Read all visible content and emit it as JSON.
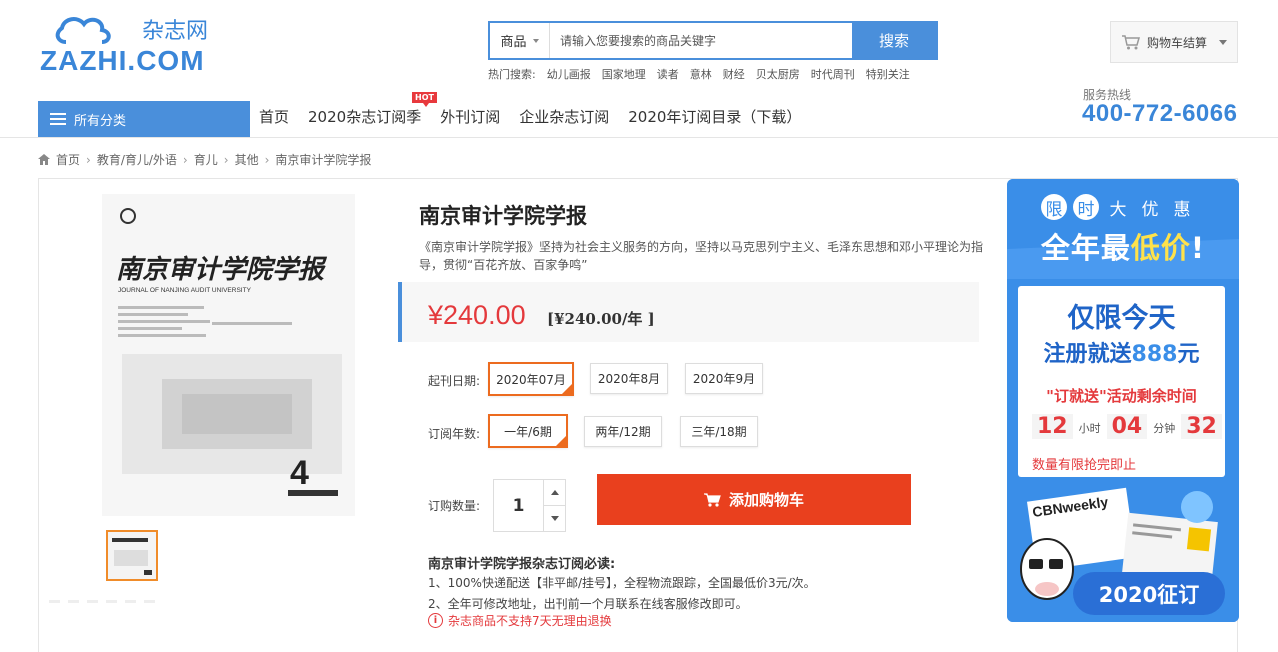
{
  "header": {
    "logo_text_cn": "杂志网",
    "logo_text_en": "ZAZHI.COM",
    "search": {
      "category": "商品",
      "placeholder": "请输入您要搜索的商品关键字",
      "button": "搜索"
    },
    "hot_label": "热门搜索:",
    "hot_terms": [
      "幼儿画报",
      "国家地理",
      "读者",
      "意林",
      "财经",
      "贝太厨房",
      "时代周刊",
      "特别关注"
    ],
    "cart": "购物车结算",
    "service_label": "服务热线",
    "service_phone": "400-772-6066"
  },
  "nav": {
    "all_categories": "所有分类",
    "items": [
      "首页",
      "2020杂志订阅季",
      "外刊订阅",
      "企业杂志订阅",
      "2020年订阅目录（下载）"
    ],
    "hot_badge": "HOT"
  },
  "breadcrumb": [
    "首页",
    "教育/育儿/外语",
    "育儿",
    "其他",
    "南京审计学院学报"
  ],
  "product": {
    "title": "南京审计学院学报",
    "description": "《南京审计学院学报》坚持为社会主义服务的方向，坚持以马克思列宁主义、毛泽东思想和邓小平理论为指导，贯彻“百花齐放、百家争鸣”",
    "price": "¥240.00",
    "price_per_year": "[¥240.00/年 ]",
    "cover_title": "南京审计学院学报",
    "cover_subtitle": "JOURNAL OF NANJING AUDIT UNIVERSITY",
    "cover_issue": "4",
    "start_label": "起刊日期:",
    "start_options": [
      "2020年07月",
      "2020年8月",
      "2020年9月"
    ],
    "start_selected": 0,
    "years_label": "订阅年数:",
    "year_options": [
      "一年/6期",
      "两年/12期",
      "三年/18期"
    ],
    "year_selected": 0,
    "qty_label": "订购数量:",
    "qty": "1",
    "add_cart": "添加购物车",
    "notes_title": "南京审计学院学报杂志订阅必读:",
    "notes": [
      "1、100%快递配送【非平邮/挂号】，全程物流跟踪，全国最低价3元/次。",
      "2、全年可修改地址，出刊前一个月联系在线客服修改即可。"
    ],
    "warning": "杂志商品不支持7天无理由退换"
  },
  "ad": {
    "small_chars": [
      "限",
      "时",
      "大",
      "优",
      "惠"
    ],
    "headline_a": "全年最",
    "headline_b": "低价",
    "headline_c": "!",
    "card_line1": "仅限今天",
    "card_line2a": "注册就送",
    "card_line2b": "888",
    "card_line2c": "元",
    "card_line3": "\"订就送\"活动剩余时间",
    "timer": [
      "12",
      "04",
      "32"
    ],
    "timer_units": [
      "小时",
      "分钟"
    ],
    "card_line4": "数量有限抢完即止",
    "magazine_label": "CBNweekly",
    "cta": "2020征订"
  },
  "colors": {
    "brand_blue": "#4a8fdb",
    "price_red": "#e4393c",
    "cart_orange": "#e9401e",
    "select_orange": "#ec6b1f"
  }
}
